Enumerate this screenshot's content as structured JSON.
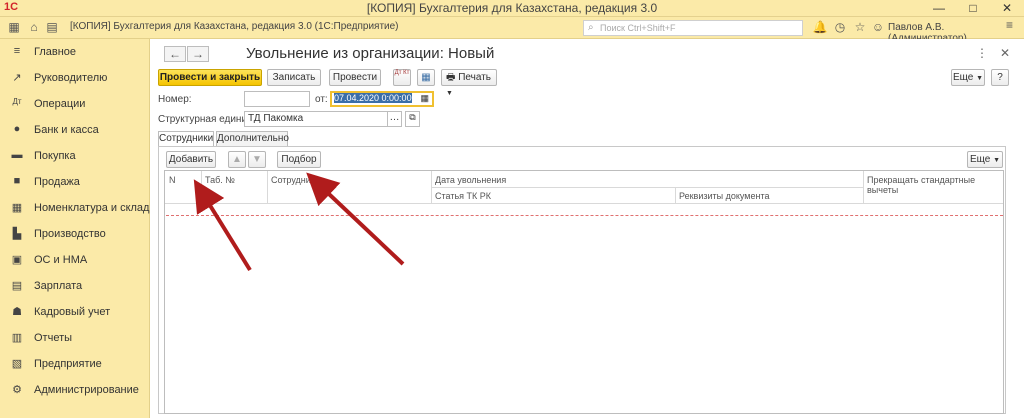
{
  "window": {
    "title": "[КОПИЯ] Бухгалтерия для Казахстана, редакция 3.0",
    "logo": "1С",
    "minimize": "—",
    "maximize": "□",
    "close": "✕"
  },
  "appbar": {
    "title": "[КОПИЯ] Бухгалтерия для Казахстана, редакция 3.0  (1С:Предприятие)",
    "search_placeholder": "Поиск Ctrl+Shift+F",
    "user": "Павлов А.В. (Администратор)"
  },
  "sidebar": {
    "items": [
      {
        "label": "Главное",
        "icon": "≡"
      },
      {
        "label": "Руководителю",
        "icon": "↗"
      },
      {
        "label": "Операции",
        "icon": "Дт"
      },
      {
        "label": "Банк и касса",
        "icon": "●"
      },
      {
        "label": "Покупка",
        "icon": "▬"
      },
      {
        "label": "Продажа",
        "icon": "■"
      },
      {
        "label": "Номенклатура и склад",
        "icon": "▦"
      },
      {
        "label": "Производство",
        "icon": "▙"
      },
      {
        "label": "ОС и НМА",
        "icon": "▣"
      },
      {
        "label": "Зарплата",
        "icon": "▤"
      },
      {
        "label": "Кадровый учет",
        "icon": "☗"
      },
      {
        "label": "Отчеты",
        "icon": "▥"
      },
      {
        "label": "Предприятие",
        "icon": "▧"
      },
      {
        "label": "Администрирование",
        "icon": "⚙"
      }
    ]
  },
  "form": {
    "title": "Увольнение из организации: Новый",
    "back": "←",
    "forward": "→",
    "more_vert": "⋮",
    "close": "✕",
    "toolbar": {
      "post_close": "Провести и закрыть",
      "save": "Записать",
      "post": "Провести",
      "dt_kt": "Дт Кт",
      "print": "Печать",
      "more": "Еще",
      "help": "?"
    },
    "number_label": "Номер:",
    "number_value": "",
    "date_label": "от:",
    "date_value": "07.04.2020  0:00:00",
    "unit_label": "Структурная единица:",
    "unit_value": "ТД Пакомка",
    "tabs": [
      {
        "label": "Сотрудники"
      },
      {
        "label": "Дополнительно"
      }
    ],
    "table_toolbar": {
      "add": "Добавить",
      "select": "Подбор",
      "more": "Еще"
    },
    "columns": {
      "n": "N",
      "tab": "Таб. №",
      "employee": "Сотрудник",
      "dismissal_date": "Дата увольнения",
      "article": "Статья ТК РК",
      "doc_details": "Реквизиты документа",
      "stop_deductions": "Прекращать стандартные вычеты"
    }
  },
  "colors": {
    "panel": "#fbeaa8",
    "primary_button": "#f5c400",
    "arrow": "#b01c1c"
  }
}
